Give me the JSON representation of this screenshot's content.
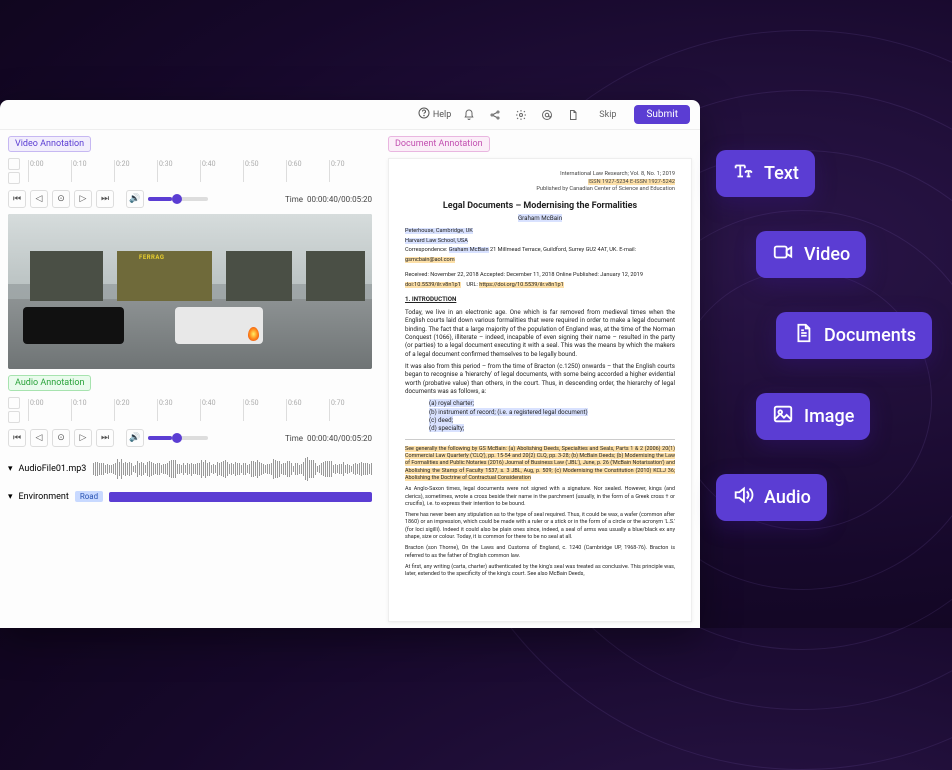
{
  "topbar": {
    "help": "Help",
    "skip": "Skip",
    "submit": "Submit"
  },
  "video": {
    "panel_label": "Video Annotation",
    "time_prefix": "Time",
    "time_current": "00:00:40",
    "time_total": "00:05:20",
    "ticks": [
      "0:00",
      "0:10",
      "0:20",
      "0:30",
      "0:40",
      "0:50",
      "0:60",
      "0:70"
    ],
    "storefront": "FERRAG"
  },
  "audio": {
    "panel_label": "Audio Annotation",
    "time_prefix": "Time",
    "time_current": "00:00:40",
    "time_total": "00:05:20",
    "ticks": [
      "0:00",
      "0:10",
      "0:20",
      "0:30",
      "0:40",
      "0:50",
      "0:60",
      "0:70"
    ],
    "file_label": "AudioFile01.mp3",
    "env_label": "Environment",
    "env_value": "Road"
  },
  "doc_panel": {
    "panel_label": "Document Annotation"
  },
  "document": {
    "journal": "International Law Research; Vol. 8, No. 1; 2019",
    "issn": "ISSN 1927-5234   E-ISSN 1927-5242",
    "publisher": "Published by Canadian Center of Science and Education",
    "title": "Legal Documents – Modernising the Formalities",
    "author": "Graham McBain",
    "affiliation1": "Peterhouse, Cambridge, UK",
    "affiliation2": "Harvard Law School, USA",
    "correspondence_label": "Correspondence:",
    "correspondence_name": "Graham McBain",
    "correspondence_addr": " 21 Millmead Terrace, Guildford, Surrey GU2 4AT, UK. E-mail:",
    "correspondence_email": "gsmcbain@aol.com",
    "received": "Received: November 22, 2018   Accepted: December 11, 2018   Online Published: January 12, 2019",
    "doi_label": "doi:10.5539/ilr.v8n1p1",
    "doi_url_label": "URL:",
    "doi_url": "https://doi.org/10.5539/ilr.v8n1p1",
    "section1": "1.  INTRODUCTION",
    "para1": "Today, we live in an electronic age. One which is far removed from medieval times when the English courts laid down various formalities that were required in order to make a legal document binding. The fact that a large majority of the population of England was, at the time of the Norman Conquest (1066), illiterate – indeed, incapable of even signing their name – resulted in the party (or parties) to a legal document executing it with a seal. This was the means by which the makers of a legal document confirmed themselves to be legally bound.",
    "para2": "It was also from this period – from the time of Bracton (c.1250) onwards – that the English courts began to recognise a 'hierarchy' of legal documents, with some being accorded a higher evidential worth (probative value) than others, in the court. Thus, in descending order, the hierarchy of legal documents was as follows, a:",
    "list_a": "(a) royal charter;",
    "list_b": "(b) instrument of record; (i.e. a registered legal document)",
    "list_c": "(c) deed;",
    "list_d": "(d) specialty;",
    "footnote1": "See generally the following by GS McBain: (a) Abolishing Deeds, Specialties and Seals, Parts 1 & 2 (2006) 20(1) Commercial Law Quarterly ('CLQ'), pp. 15-54 and 20(2) CLQ, pp. 3-28; (b) McBain Deeds; (b) Modernising the Law of Formalities and Public Notaries (2016) Journal of Business Law ('JBL'), June, p. 26 ('McBain Notarisation') and Abolishing the Stamp of Faculty 1537, s. 3 JBL, Aug, p. 509; (c) Modernising the Constitution (2010) KCLJ 36; Abolishing the Doctrine of Contractual Consideration",
    "footnote2": "As Anglo-Saxon times, legal documents were not signed with a signature. Nor sealed. However, kings (and clerics), sometimes, wrote a cross beside their name in the parchment (usually, in the form of a Greek cross † or crucifix), i.e. to express their intention to be bound.",
    "footnote3": "There has never been any stipulation as to the type of seal required. Thus, it could be wax, a wafer (common after 1860) or an impression, which could be made with a ruler or a stick or in the form of a circle or the acronym 'L.S.' (for loci sigilli). Indeed it could also be plain ones since, indeed, a seal of arms was usually a blue/black ex any shape, size or colour. Today, it is common for there to be no seal at all.",
    "footnote4": "Bracton (son Thorne), On the Laws and Customs of England, c. 1240 (Cambridge UP, 1968-76). Bracton is referred to as the father of English common law.",
    "footnote5": "At first, any writing (carta, charter) authenticated by the king's seal was treated as conclusive. This principle was, later, extended to the specificity of the king's court. See also McBain Deeds,"
  },
  "chips": {
    "text": "Text",
    "video": "Video",
    "documents": "Documents",
    "image": "Image",
    "audio": "Audio"
  }
}
